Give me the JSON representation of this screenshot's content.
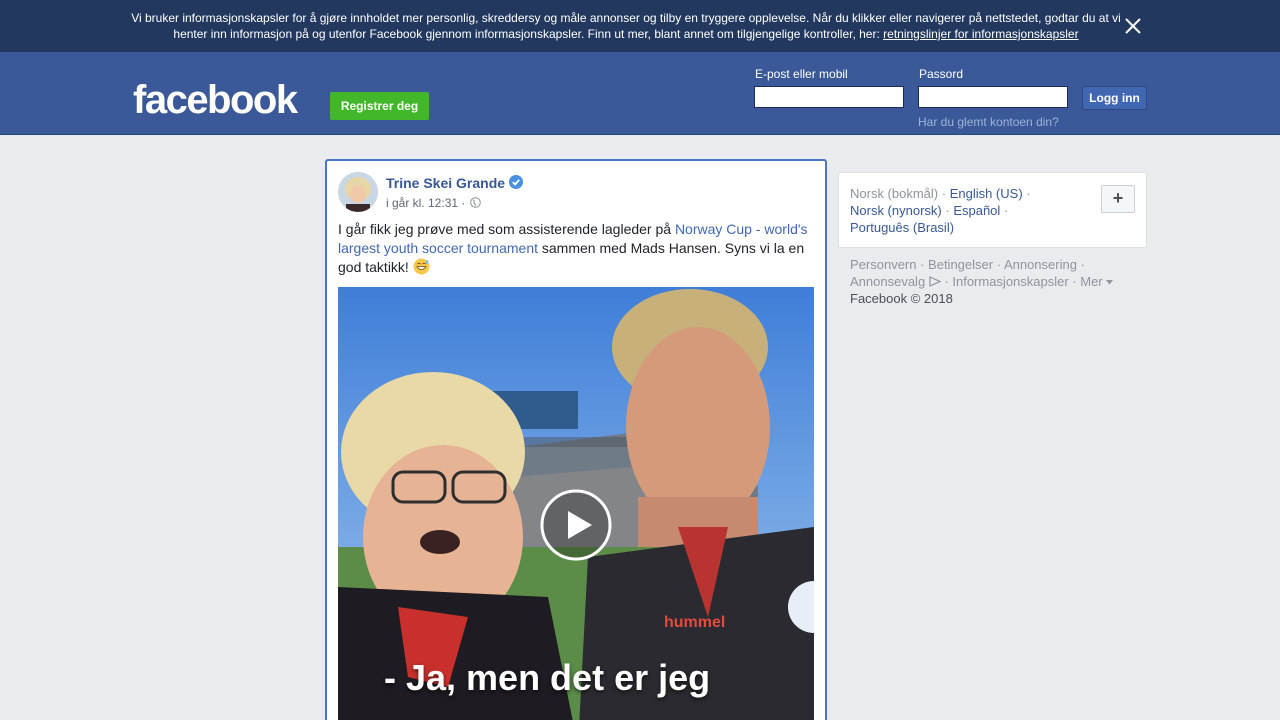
{
  "cookie_banner": {
    "text": "Vi bruker informasjonskapsler for å gjøre innholdet mer personlig, skreddersy og måle annonser og tilby en tryggere opplevelse. Når du klikker eller navigerer på nettstedet, godtar du at vi henter inn informasjon på og utenfor Facebook gjennom informasjonskapsler. Finn ut mer, blant annet om tilgjengelige kontroller, her:",
    "link": "retningslinjer for informasjonskapsler",
    "close_icon": "close-icon"
  },
  "header": {
    "logo": "facebook",
    "register_label": "Registrer deg",
    "email_label": "E-post eller mobil",
    "email_value": "",
    "password_label": "Passord",
    "password_value": "",
    "login_label": "Logg inn",
    "forgot_link": "Har du glemt kontoen din?",
    "brand_color": "#3b5998",
    "register_color": "#42b72a"
  },
  "post": {
    "author": "Trine Skei Grande",
    "verified_icon": "verified-badge-icon",
    "time": "i går kl. 12:31 ·",
    "privacy_icon": "globe-icon",
    "text_before": "I går fikk jeg prøve med som assisterende lagleder på ",
    "text_link": "Norway Cup - world's largest youth soccer tournament",
    "text_after": " sammen med Mads Hansen. Syns vi la en god taktikk!",
    "emoji_icon": "grinning-sweat-emoji-icon",
    "video": {
      "play_icon": "play-icon",
      "caption": "- Ja, men det er jeg",
      "jersey_text": "hummel"
    }
  },
  "sidebar": {
    "languages": {
      "current": "Norsk (bokmål)",
      "items": [
        "English (US)",
        "Norsk (nynorsk)",
        "Español",
        "Português (Brasil)"
      ],
      "add_icon": "plus-icon",
      "add_label": "+"
    },
    "footer": {
      "links": [
        "Personvern",
        "Betingelser",
        "Annonsering",
        "Annonsevalg",
        "Informasjonskapsler",
        "Mer"
      ],
      "adchoices_icon": "adchoices-icon",
      "more_icon": "caret-down-icon",
      "copyright": "Facebook © 2018"
    }
  }
}
